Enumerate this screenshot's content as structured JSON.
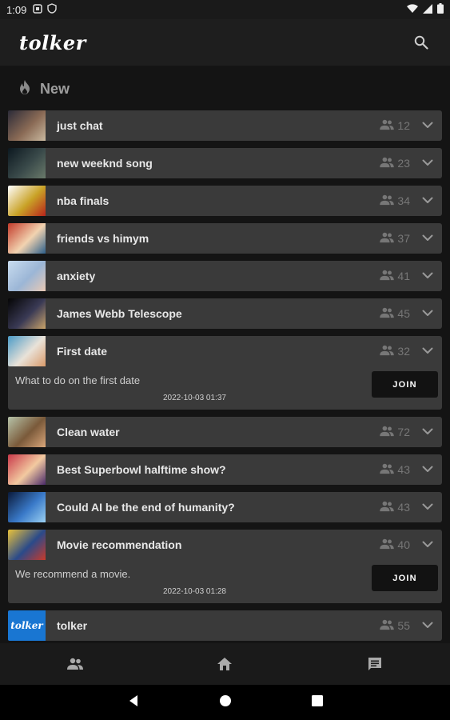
{
  "status_bar": {
    "time": "1:09"
  },
  "app": {
    "title": "tolker"
  },
  "section": {
    "label": "New"
  },
  "rooms": [
    {
      "title": "just chat",
      "count": "12",
      "thumb_colors": [
        "#2b2b38",
        "#8a6a55",
        "#c9b9a0"
      ]
    },
    {
      "title": "new weeknd song",
      "count": "23",
      "thumb_colors": [
        "#0c1820",
        "#3a4a4a",
        "#6a7a6a"
      ]
    },
    {
      "title": "nba finals",
      "count": "34",
      "thumb_colors": [
        "#ffffff",
        "#c9a227",
        "#b8231b"
      ]
    },
    {
      "title": "friends vs himym",
      "count": "37",
      "thumb_colors": [
        "#c23a2a",
        "#f2d3b0",
        "#2c5f8a"
      ]
    },
    {
      "title": "anxiety",
      "count": "41",
      "thumb_colors": [
        "#c9dcef",
        "#9bb6d6",
        "#e9c9b5"
      ]
    },
    {
      "title": "James Webb Telescope",
      "count": "45",
      "thumb_colors": [
        "#050505",
        "#3a3a55",
        "#c9a36a"
      ]
    },
    {
      "title": "First date",
      "count": "32",
      "thumb_colors": [
        "#4a9bc7",
        "#e9e2d8",
        "#d99a6a"
      ],
      "description": "What to do on the first date",
      "date": "2022-10-03 01:37",
      "join_label": "JOIN"
    },
    {
      "title": "Clean water",
      "count": "72",
      "thumb_colors": [
        "#b6c3a9",
        "#7a5a3a",
        "#d9a67a"
      ]
    },
    {
      "title": "Best Superbowl halftime show?",
      "count": "43",
      "thumb_colors": [
        "#c9394a",
        "#f2c9a0",
        "#4a2a6a"
      ]
    },
    {
      "title": "Could AI be the end of humanity?",
      "count": "43",
      "thumb_colors": [
        "#0a1a3a",
        "#3a7ac9",
        "#9ad0f2"
      ]
    },
    {
      "title": "Movie recommendation",
      "count": "40",
      "thumb_colors": [
        "#e9c23a",
        "#2a4a8a",
        "#c93a2a"
      ],
      "description": "We recommend a movie.",
      "date": "2022-10-03 01:28",
      "join_label": "JOIN"
    },
    {
      "title": "tolker",
      "count": "55",
      "thumb_colors": [
        "#1976d2",
        "#1976d2",
        "#1976d2"
      ],
      "thumb_text": "tolker"
    }
  ],
  "bottom_nav": [
    {
      "icon": "people-icon"
    },
    {
      "icon": "home-icon"
    },
    {
      "icon": "chat-icon"
    }
  ],
  "colors": {
    "card": "#3a3a3a",
    "background": "#141414",
    "join_button": "#121212"
  }
}
